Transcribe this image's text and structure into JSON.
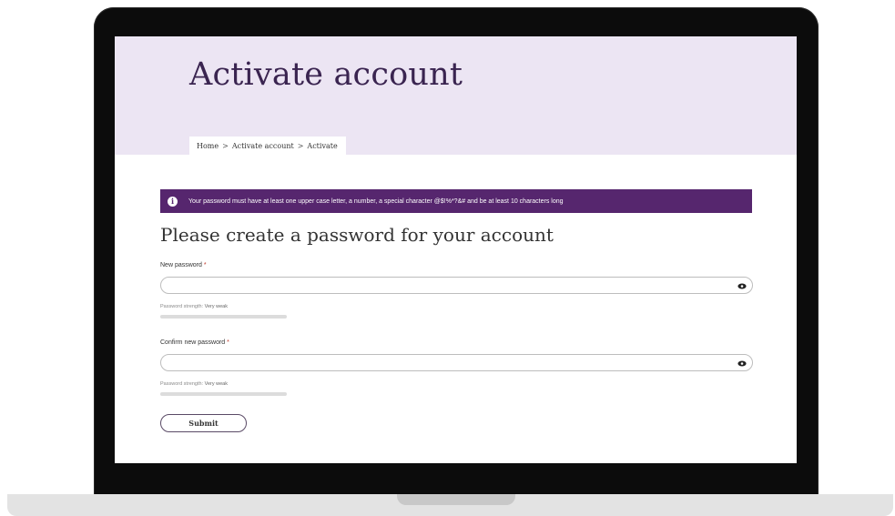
{
  "page": {
    "title": "Activate account",
    "breadcrumb": [
      "Home",
      "Activate account",
      "Activate"
    ],
    "breadcrumb_separator": ">"
  },
  "banner": {
    "message": "Your password must have at least one upper case letter, a number, a special character @$!%*?&# and be at least 10 characters long",
    "icon": "info-icon",
    "background": "#56266e"
  },
  "form": {
    "heading": "Please create a password for your account",
    "new_password": {
      "label": "New password",
      "required_marker": "*",
      "value": "",
      "strength_label": "Password strength:",
      "strength_value": "Very weak",
      "toggle_icon": "eye-icon"
    },
    "confirm_password": {
      "label": "Confirm new password",
      "required_marker": "*",
      "value": "",
      "strength_label": "Password strength:",
      "strength_value": "Very weak",
      "toggle_icon": "eye-icon"
    },
    "submit_label": "Submit"
  },
  "colors": {
    "hero_background": "#ece5f3",
    "accent": "#56266e",
    "title": "#3a2450"
  }
}
